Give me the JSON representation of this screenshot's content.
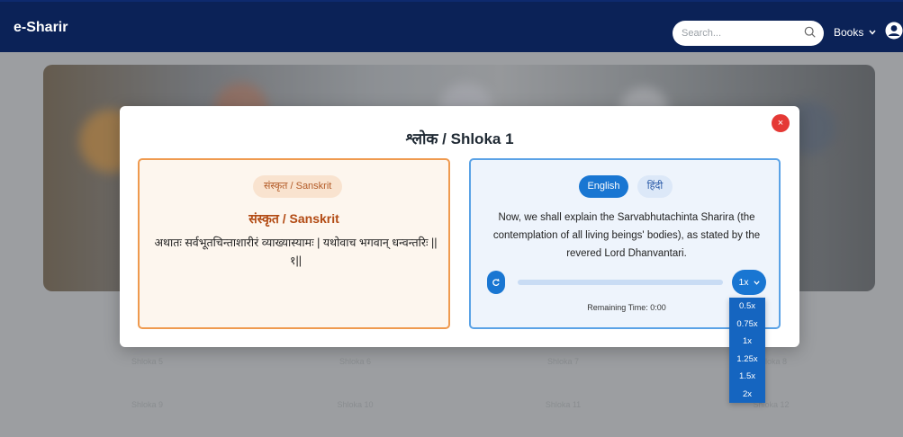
{
  "navbar": {
    "brand": "e-Sharir",
    "search_placeholder": "Search...",
    "books_label": "Books"
  },
  "background": {
    "row1": [
      "Shloka 5",
      "Shloka 6",
      "Shloka 7",
      "Shloka 8"
    ],
    "row2": [
      "Shloka 9",
      "Shloka 10",
      "Shloka 11",
      "Shloka 12"
    ]
  },
  "modal": {
    "title": "श्लोक / Shloka 1",
    "close_label": "×",
    "sanskrit": {
      "pill_label": "संस्कृत / Sanskrit",
      "heading": "संस्कृत / Sanskrit",
      "text": "अथातः सर्वभूतचिन्ताशारीरं व्याख्यास्यामः | यथोवाच भगवान् धन्वन्तरिः ||१||"
    },
    "translation": {
      "tab_english": "English",
      "tab_hindi": "हिंदी",
      "text": "Now, we shall explain the Sarvabhutachinta Sharira (the contemplation of all living beings' bodies), as stated by the revered Lord Dhanvantari.",
      "speed_label": "1x",
      "remaining_time": "Remaining Time: 0:00",
      "progress": 0
    },
    "speed_options": [
      "0.5x",
      "0.75x",
      "1x",
      "1.25x",
      "1.5x",
      "2x"
    ]
  },
  "colors": {
    "navbar": "#0b2257",
    "accent_blue": "#1976d2",
    "accent_orange": "#ef9a4f",
    "close_red": "#e53935"
  }
}
